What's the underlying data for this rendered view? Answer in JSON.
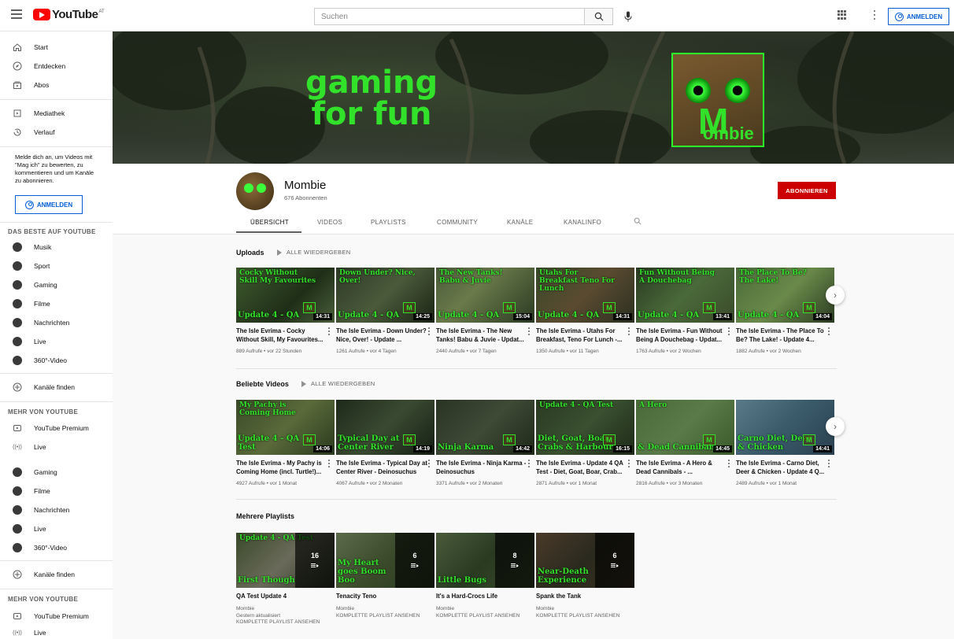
{
  "header": {
    "logo_text": "YouTube",
    "logo_region": "AT",
    "search_placeholder": "Suchen",
    "signin_label": "ANMELDEN"
  },
  "sidebar": {
    "main": [
      {
        "label": "Start",
        "icon": "home-icon"
      },
      {
        "label": "Entdecken",
        "icon": "compass-icon"
      },
      {
        "label": "Abos",
        "icon": "subscriptions-icon"
      }
    ],
    "library": [
      {
        "label": "Mediathek",
        "icon": "library-icon"
      },
      {
        "label": "Verlauf",
        "icon": "history-icon"
      }
    ],
    "signin_note": "Melde dich an, um Videos mit \"Mag ich\" zu bewerten, zu kommentieren und um Kanäle zu abonnieren.",
    "signin_label": "ANMELDEN",
    "best_heading": "DAS BESTE AUF YOUTUBE",
    "best": [
      "Musik",
      "Sport",
      "Gaming",
      "Filme",
      "Nachrichten",
      "Live",
      "360°-Video"
    ],
    "find_channels": "Kanäle finden",
    "more_heading": "MEHR VON YOUTUBE",
    "more": [
      "YouTube Premium",
      "Live"
    ],
    "repeat": [
      "Gaming",
      "Filme",
      "Nachrichten",
      "Live",
      "360°-Video"
    ],
    "find_channels_2": "Kanäle finden",
    "more_heading_2": "MEHR VON YOUTUBE",
    "more_2": [
      "YouTube Premium",
      "Live"
    ]
  },
  "banner": {
    "line1": "gaming",
    "line2": "for fun",
    "logo_letter": "M",
    "logo_word": "ombie"
  },
  "channel": {
    "name": "Mombie",
    "subscribers": "676 Abonnenten",
    "subscribe_label": "ABONNIEREN",
    "tabs": [
      "ÜBERSICHT",
      "VIDEOS",
      "PLAYLISTS",
      "COMMUNITY",
      "KANÄLE",
      "KANALINFO"
    ]
  },
  "uploads": {
    "title": "Uploads",
    "play_all": "ALLE WIEDERGEBEN",
    "videos": [
      {
        "thumb_top": "Cocky Without Skill My Favourites",
        "thumb_bottom": "Update 4 - QA",
        "duration": "14:31",
        "title": "The Isle Evrima - Cocky Without Skill, My Favourites...",
        "meta": "889 Aufrufe • vor 22 Stunden"
      },
      {
        "thumb_top": "Down Under? Nice, Over!",
        "thumb_bottom": "Update 4 - QA",
        "duration": "14:25",
        "title": "The Isle Evrima - Down Under? Nice, Over! - Update ...",
        "meta": "1261 Aufrufe • vor 4 Tagen"
      },
      {
        "thumb_top": "The New Tanks! Babu & Juvie",
        "thumb_bottom": "Update 4 - QA",
        "duration": "15:04",
        "title": "The Isle Evrima - The New Tanks! Babu & Juvie - Updat...",
        "meta": "2440 Aufrufe • vor 7 Tagen"
      },
      {
        "thumb_top": "Utahs For Breakfast Teno For Lunch",
        "thumb_bottom": "Update 4 - QA",
        "duration": "14:31",
        "title": "The Isle Evrima - Utahs For Breakfast, Teno For Lunch -...",
        "meta": "1350 Aufrufe • vor 11 Tagen"
      },
      {
        "thumb_top": "Fun Without Being A Douchebag",
        "thumb_bottom": "Update 4 - QA",
        "duration": "13:41",
        "title": "The Isle Evrima - Fun Without Being A Douchebag - Updat...",
        "meta": "1763 Aufrufe • vor 2 Wochen"
      },
      {
        "thumb_top": "The Place To Be? The Lake!",
        "thumb_bottom": "Update 4 - QA",
        "duration": "14:04",
        "title": "The Isle Evrima - The Place To Be? The Lake! - Update 4...",
        "meta": "1882 Aufrufe • vor 2 Wochen"
      }
    ]
  },
  "popular": {
    "title": "Beliebte Videos",
    "play_all": "ALLE WIEDERGEBEN",
    "videos": [
      {
        "thumb_top": "My Pachy is Coming Home",
        "thumb_bottom": "Update 4 - QA Test",
        "duration": "14:06",
        "title": "The Isle Evrima - My Pachy is Coming Home (incl. Turtle!)...",
        "meta": "4927 Aufrufe • vor 1 Monat"
      },
      {
        "thumb_top": "",
        "thumb_bottom": "Typical Day at Center River",
        "duration": "14:19",
        "title": "The Isle Evrima - Typical Day at Center River - Deinosuchus",
        "meta": "4067 Aufrufe • vor 2 Monaten"
      },
      {
        "thumb_top": "",
        "thumb_bottom": "Ninja Karma",
        "duration": "14:42",
        "title": "The Isle Evrima - Ninja Karma - Deinosuchus",
        "meta": "3371 Aufrufe • vor 2 Monaten"
      },
      {
        "thumb_top": "Update 4 - QA Test",
        "thumb_bottom": "Diet, Goat, Boar, Crabs & Harbour",
        "duration": "16:15",
        "title": "The Isle Evrima - Update 4 QA Test - Diet, Goat, Boar, Crab...",
        "meta": "2871 Aufrufe • vor 1 Monat"
      },
      {
        "thumb_top": "A Hero",
        "thumb_bottom": "& Dead Cannibals",
        "duration": "14:45",
        "title": "The Isle Evrima - A Hero & Dead Cannibals - ...",
        "meta": "2816 Aufrufe • vor 3 Monaten"
      },
      {
        "thumb_top": "",
        "thumb_bottom": "Carno Diet, Deer & Chicken",
        "duration": "14:41",
        "title": "The Isle Evrima - Carno Diet, Deer & Chicken - Update 4 Q...",
        "meta": "2489 Aufrufe • vor 1 Monat"
      }
    ]
  },
  "playlists": {
    "title": "Mehrere Playlists",
    "items": [
      {
        "thumb_top": "Update 4 - QA Test",
        "thumb_bottom": "First Though",
        "count": "16",
        "title": "QA Test Update 4",
        "channel": "Mombie",
        "updated": "Gestern aktualisiert",
        "link": "KOMPLETTE PLAYLIST ANSEHEN"
      },
      {
        "thumb_top": "",
        "thumb_bottom": "My Heart goes Boom Boo",
        "count": "6",
        "title": "Tenacity Teno",
        "channel": "Mombie",
        "updated": "",
        "link": "KOMPLETTE PLAYLIST ANSEHEN"
      },
      {
        "thumb_top": "",
        "thumb_bottom": "Little Bugs",
        "count": "8",
        "title": "It's a Hard-Crocs Life",
        "channel": "Mombie",
        "updated": "",
        "link": "KOMPLETTE PLAYLIST ANSEHEN"
      },
      {
        "thumb_top": "",
        "thumb_bottom": "Near-Death Experience",
        "count": "6",
        "title": "Spank the Tank",
        "channel": "Mombie",
        "updated": "",
        "link": "KOMPLETTE PLAYLIST ANSEHEN"
      }
    ]
  },
  "colors": {
    "brand_red": "#ff0000",
    "subscribe_red": "#cc0000",
    "link_blue": "#065fd4",
    "thumb_green": "#32e12a"
  }
}
